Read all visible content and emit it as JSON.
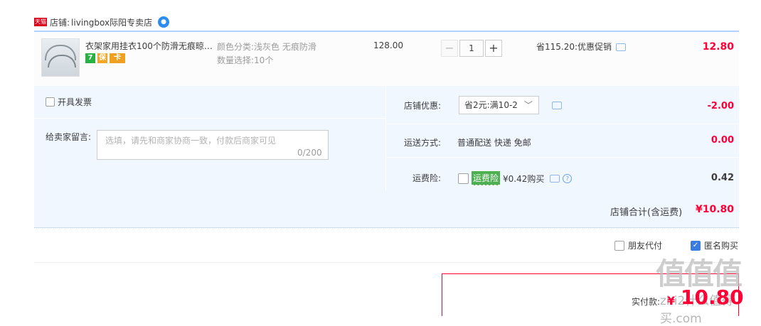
{
  "store": {
    "badge": "天猫",
    "prefix": "店铺:",
    "name": "livingbox际阳专卖店",
    "ww_icon": "wangwang-chat-icon"
  },
  "item": {
    "title": "衣架家用挂衣100个防滑无痕晾…",
    "badges": [
      "7",
      "保",
      "卡"
    ],
    "sku_color_label": "颜色分类:",
    "sku_color_value": "浅灰色 无痕防滑",
    "sku_qty_label": "数量选择:",
    "sku_qty_value": "10个",
    "price": "128.00",
    "quantity": "1",
    "minus": "−",
    "plus": "+",
    "promo": "省115.20:优惠促销",
    "subtotal": "12.80"
  },
  "options": {
    "invoice_label": "开具发票",
    "message_label": "给卖家留言:",
    "message_placeholder": "选填，请先和商家协商一致，付款后商家可见",
    "message_count": "0/200",
    "coupon_label": "店铺优惠:",
    "coupon_value": "省2元:满10-2",
    "coupon_arrow": "﹀",
    "coupon_amount": "-2.00",
    "shipping_label": "运送方式:",
    "shipping_value": "普通配送 快递 免邮",
    "shipping_amount": "0.00",
    "insurance_label": "运费险:",
    "insurance_tag": "运费险",
    "insurance_value": "¥0.42购买",
    "insurance_help": "?",
    "insurance_amount": "0.42"
  },
  "total": {
    "label": "店铺合计(含运费)",
    "value": "¥10.80"
  },
  "checkout": {
    "friend_pay": "朋友代付",
    "anonymous": "匿名购买",
    "check_mark": "✓",
    "pay_label": "实付款:",
    "pay_symbol": "¥",
    "pay_value": "10.80"
  },
  "watermark": {
    "text": "值值值",
    "site": "zhi2什么值得买.com"
  },
  "colors": {
    "accent_red": "#ff0036",
    "border_blue": "#b2d1ff",
    "panel_bg": "#f1f7ff",
    "checkbox_blue": "#3b7ce0"
  }
}
